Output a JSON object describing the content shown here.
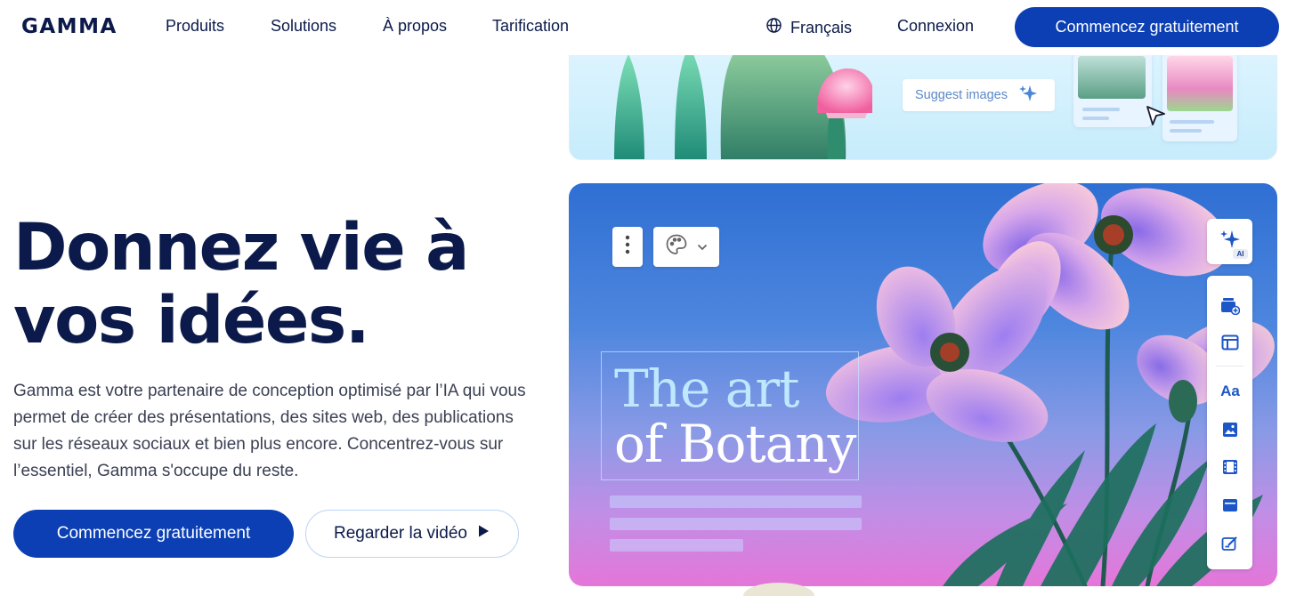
{
  "header": {
    "logo": "GAMMA",
    "nav": [
      "Produits",
      "Solutions",
      "À propos",
      "Tarification"
    ],
    "language": "Français",
    "login": "Connexion",
    "cta": "Commencez gratuitement"
  },
  "hero": {
    "title_line1": "Donnez vie à",
    "title_line2": "vos idées.",
    "description": "Gamma est votre partenaire de conception optimisé par l’IA qui vous permet de créer des présentations, des sites web, des publications sur les réseaux sociaux et bien plus encore. Concentrez-vous sur l’essentiel, Gamma s'occupe du reste.",
    "primary_button": "Commencez gratuitement",
    "secondary_button": "Regarder la vidéo"
  },
  "preview": {
    "suggest_label": "Suggest images",
    "card_title_line1": "The art",
    "card_title_line2": "of Botany",
    "ai_badge": "AI",
    "text_tool": "Aa"
  },
  "colors": {
    "brand": "#0b3fb3",
    "text_dark": "#0b1a4a",
    "accent_icon": "#1d56c7"
  },
  "icons": [
    "globe-icon",
    "play-icon",
    "sparkle-icon",
    "cursor-icon",
    "more-vertical-icon",
    "palette-icon",
    "chevron-down-icon",
    "add-card-icon",
    "layout-icon",
    "text-icon",
    "image-icon",
    "video-icon",
    "embed-icon",
    "form-icon"
  ]
}
